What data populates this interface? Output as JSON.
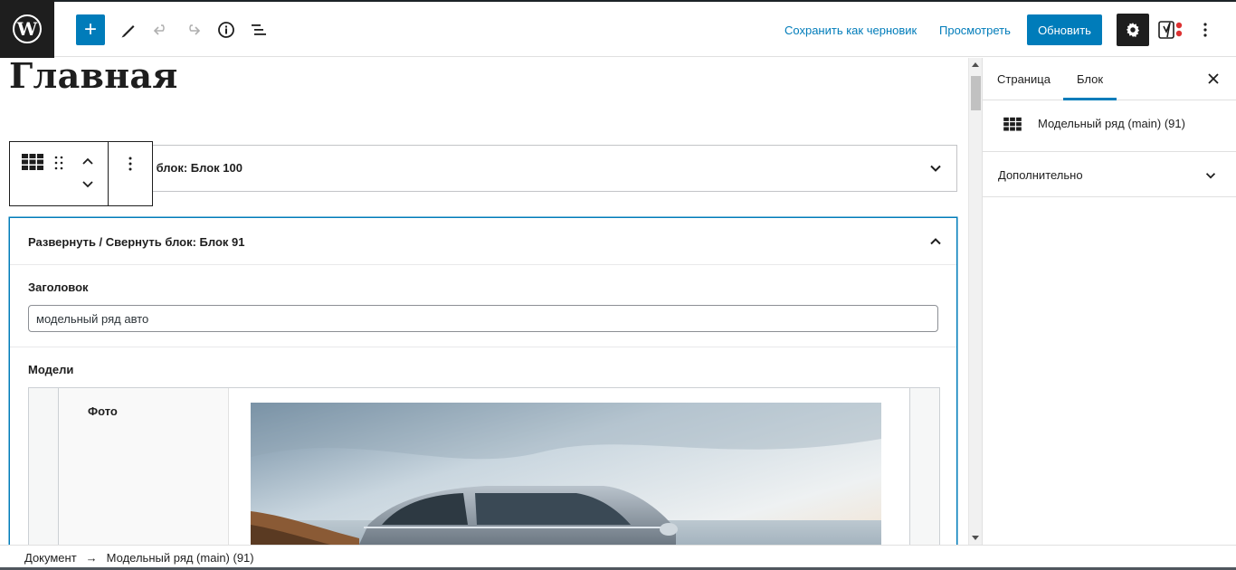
{
  "toolbar": {
    "logo": "W",
    "add_icon": "+",
    "save_draft_label": "Сохранить как черновик",
    "preview_label": "Просмотреть",
    "update_label": "Обновить",
    "icons": [
      "wordpress-logo-icon",
      "plus-icon",
      "pencil-icon",
      "undo-icon",
      "redo-icon",
      "info-icon",
      "list-view-icon",
      "gear-icon",
      "yoast-icon",
      "more-vertical-icon"
    ]
  },
  "editor": {
    "page_title": "Главная",
    "collapsed_block_title": "ь блок: Блок 100",
    "open_block_title": "Развернуть / Свернуть блок: Блок 91",
    "heading_label": "Заголовок",
    "heading_value": "модельный ряд авто",
    "models_label": "Модели",
    "photo_label": "Фото"
  },
  "sidebar": {
    "tabs": [
      {
        "label": "Страница"
      },
      {
        "label": "Блок"
      }
    ],
    "block_name": "Модельный ряд (main) (91)",
    "advanced_label": "Дополнительно"
  },
  "footer": {
    "crumb_root": "Документ",
    "crumb_sep": "→",
    "crumb_current": "Модельный ряд (main) (91)"
  },
  "colors": {
    "accent": "#007cba",
    "dark": "#1e1e1e"
  }
}
